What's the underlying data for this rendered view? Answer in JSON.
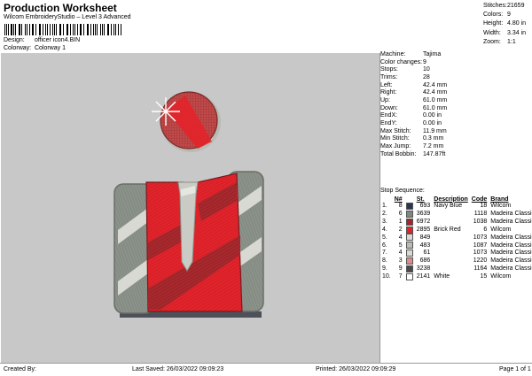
{
  "header": {
    "title": "Production Worksheet",
    "subtitle": "Wilcom EmbroideryStudio – Level 3 Advanced",
    "design_label": "Design:",
    "design_value": "officer icon4.BIN",
    "colorway_label": "Colorway:",
    "colorway_value": "Colorway 1"
  },
  "stats": [
    {
      "label": "Stitches:",
      "value": "21659"
    },
    {
      "label": "Colors:",
      "value": "9"
    },
    {
      "label": "Height:",
      "value": "4.80 in"
    },
    {
      "label": "Width:",
      "value": "3.34 in"
    },
    {
      "label": "Zoom:",
      "value": "1:1"
    }
  ],
  "machine_info": [
    {
      "label": "Machine:",
      "value": "Tajima"
    },
    {
      "label": "Color changes:",
      "value": "9"
    },
    {
      "label": "Stops:",
      "value": "10"
    },
    {
      "label": "Trims:",
      "value": "28"
    },
    {
      "label": "Left:",
      "value": "42.4 mm"
    },
    {
      "label": "Right:",
      "value": "42.4 mm"
    },
    {
      "label": "Up:",
      "value": "61.0 mm"
    },
    {
      "label": "Down:",
      "value": "61.0 mm"
    },
    {
      "label": "EndX:",
      "value": "0.00 in"
    },
    {
      "label": "EndY:",
      "value": "0.00 in"
    },
    {
      "label": "Max Stitch:",
      "value": "11.9 mm"
    },
    {
      "label": "Min Stitch:",
      "value": "0.3 mm"
    },
    {
      "label": "Max Jump:",
      "value": "7.2 mm"
    },
    {
      "label": "Total Bobbin:",
      "value": "147.87ft"
    }
  ],
  "stop_sequence": {
    "heading": "Stop Sequence:",
    "columns": {
      "n": "N#",
      "st": "St.",
      "description": "Description",
      "code": "Code",
      "brand": "Brand"
    },
    "rows": [
      {
        "stop": "1.",
        "n": "8",
        "color": "#2b3550",
        "st": "693",
        "description": "Navy Blue",
        "code": "18",
        "brand": "Wilcom"
      },
      {
        "stop": "2.",
        "n": "6",
        "color": "#7f877e",
        "st": "3639",
        "description": "",
        "code": "1118",
        "brand": "Madeira Classic 40"
      },
      {
        "stop": "3.",
        "n": "1",
        "color": "#a5262a",
        "st": "6972",
        "description": "",
        "code": "1038",
        "brand": "Madeira Classic 40"
      },
      {
        "stop": "4.",
        "n": "2",
        "color": "#e4202a",
        "st": "2895",
        "description": "Brick Red",
        "code": "6",
        "brand": "Wilcom"
      },
      {
        "stop": "5.",
        "n": "4",
        "color": "#d9d9d2",
        "st": "849",
        "description": "",
        "code": "1073",
        "brand": "Madeira Classic 40"
      },
      {
        "stop": "6.",
        "n": "5",
        "color": "#b9bcb3",
        "st": "483",
        "description": "",
        "code": "1087",
        "brand": "Madeira Classic 40"
      },
      {
        "stop": "7.",
        "n": "4",
        "color": "#d9d9d2",
        "st": "61",
        "description": "",
        "code": "1073",
        "brand": "Madeira Classic 40"
      },
      {
        "stop": "8.",
        "n": "3",
        "color": "#e08b8b",
        "st": "686",
        "description": "",
        "code": "1220",
        "brand": "Madeira Classic 40"
      },
      {
        "stop": "9.",
        "n": "9",
        "color": "#4a4a4a",
        "st": "3238",
        "description": "",
        "code": "1164",
        "brand": "Madeira Classic 40"
      },
      {
        "stop": "10.",
        "n": "7",
        "color": "#ffffff",
        "st": "2141",
        "description": "White",
        "code": "15",
        "brand": "Wilcom"
      }
    ]
  },
  "footer": {
    "created_by": "Created By:",
    "last_saved": "Last Saved: 26/03/2022 09:09:23",
    "printed": "Printed: 26/03/2022 09:09:29",
    "page": "Page 1 of 1"
  }
}
